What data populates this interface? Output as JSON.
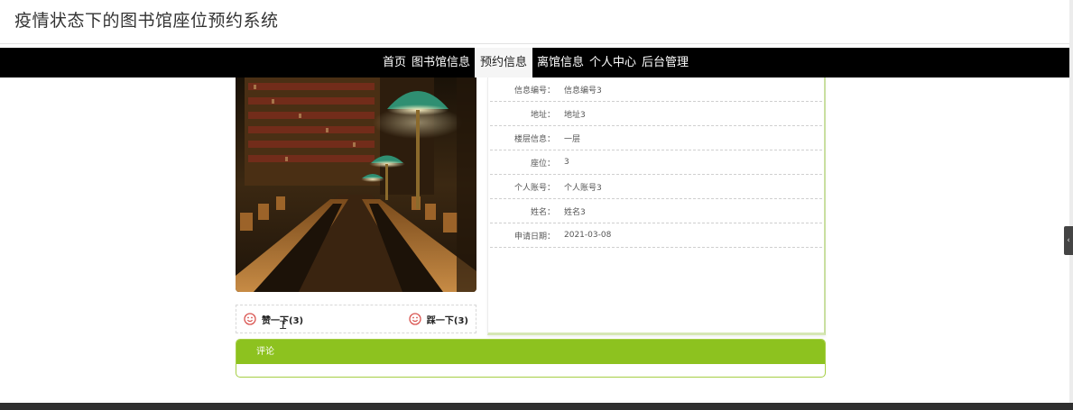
{
  "app": {
    "title": "疫情状态下的图书馆座位预约系统"
  },
  "nav": {
    "items": [
      {
        "label": "首页"
      },
      {
        "label": "图书馆信息"
      },
      {
        "label": "预约信息",
        "active": true
      },
      {
        "label": "离馆信息"
      },
      {
        "label": "个人中心"
      },
      {
        "label": "后台管理"
      }
    ]
  },
  "detail": {
    "rows": [
      {
        "label": "信息编号：",
        "value": "信息编号3"
      },
      {
        "label": "地址：",
        "value": "地址3"
      },
      {
        "label": "楼层信息：",
        "value": "一层"
      },
      {
        "label": "座位：",
        "value": "3"
      },
      {
        "label": "个人账号：",
        "value": "个人账号3"
      },
      {
        "label": "姓名：",
        "value": "姓名3"
      },
      {
        "label": "申请日期：",
        "value": "2021-03-08"
      }
    ]
  },
  "votes": {
    "like_label": "赞一下(3)",
    "dislike_label": "踩一下(3)"
  },
  "comments": {
    "header": "评论"
  },
  "colors": {
    "navbar_bg": "#000000",
    "accent_green": "#8dc21f",
    "vote_icon": "#d9534f"
  },
  "icons": {
    "like": "smile-icon",
    "dislike": "smile-icon"
  }
}
